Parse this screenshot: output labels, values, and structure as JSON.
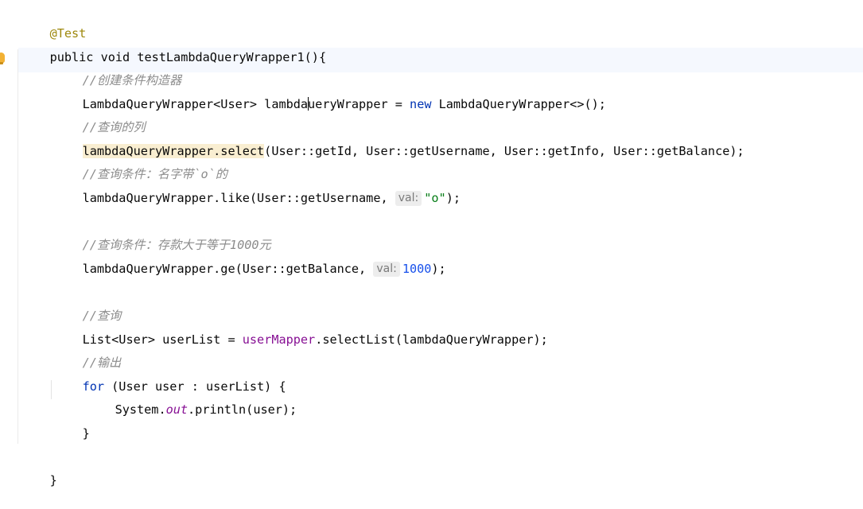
{
  "editor": {
    "annotation": "@Test",
    "signature": {
      "kw_public": "public",
      "kw_void": "void",
      "method_name": "testLambdaQueryWrapper1",
      "tail": "(){"
    },
    "lines": {
      "c1": "//创建条件构造器",
      "l2_a": "LambdaQueryWrapper<User> lambda",
      "l2_b": "ueryWrapper = ",
      "l2_kw_new": "new",
      "l2_c": " LambdaQueryWrapper<>();",
      "c2": "//查询的列",
      "l3_hl": "lambdaQueryWrapper.select",
      "l3_rest": "(User::getId, User::getUsername, User::getInfo, User::getBalance);",
      "c3": "//查询条件：名字带`o`的",
      "l4_a": "lambdaQueryWrapper.like(User::getUsername, ",
      "l4_hint": "val:",
      "l4_str": "\"o\"",
      "l4_tail": ");",
      "c4": "//查询条件：存款大于等于1000元",
      "l5_a": "lambdaQueryWrapper.ge(User::getBalance, ",
      "l5_hint": "val:",
      "l5_num": "1000",
      "l5_tail": ");",
      "c5": "//查询",
      "l6_a": "List<User> userList = ",
      "l6_field": "userMapper",
      "l6_b": ".selectList(lambdaQueryWrapper);",
      "c6": "//输出",
      "l7_kw_for": "for",
      "l7_rest": " (User user : userList) {",
      "l8_a": "System.",
      "l8_static": "out",
      "l8_b": ".println(user);",
      "l9": "}",
      "l10": "}"
    }
  },
  "colors": {
    "keyword": "#0033b3",
    "comment": "#8c8c8c",
    "annotation": "#9e880d",
    "number": "#1750eb",
    "string": "#067d17",
    "field": "#871094",
    "highlight": "#f9eed1"
  }
}
